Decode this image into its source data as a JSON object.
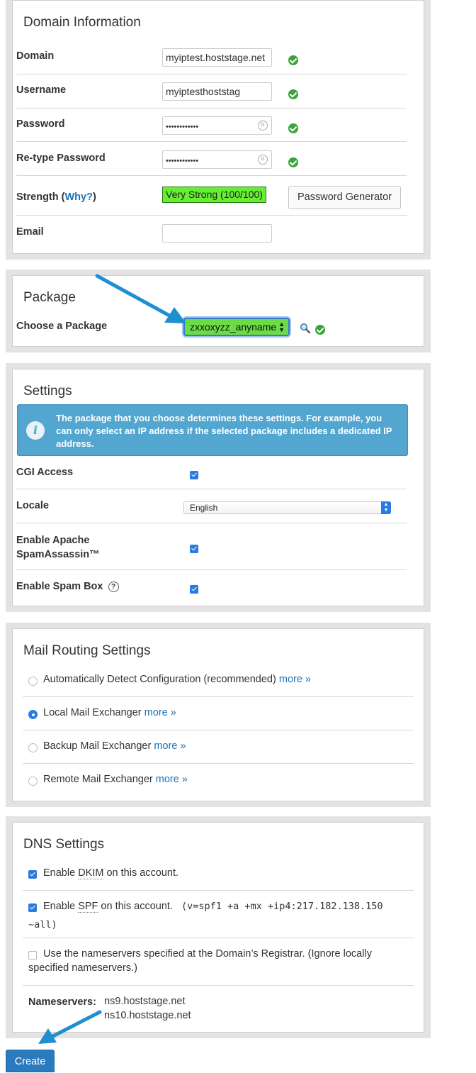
{
  "domain_info": {
    "title": "Domain Information",
    "domain_label": "Domain",
    "domain_value": "myiptest.hoststage.net",
    "username_label": "Username",
    "username_value": "myiptesthoststag",
    "password_label": "Password",
    "password_value": "••••••••••••",
    "retype_label": "Re-type Password",
    "retype_value": "••••••••••••",
    "strength_label": "Strength (",
    "strength_why": "Why?",
    "strength_close": ")",
    "strength_value": "Very Strong (100/100)",
    "generator_button": "Password Generator",
    "email_label": "Email",
    "email_value": ""
  },
  "package": {
    "title": "Package",
    "choose_label": "Choose a Package",
    "selected": "zxxoxyzz_anyname"
  },
  "settings": {
    "title": "Settings",
    "info": "The package that you choose determines these settings. For example, you can only select an IP address if the selected package includes a dedicated IP address.",
    "cgi_label": "CGI Access",
    "locale_label": "Locale",
    "locale_value": "English",
    "spamassassin_label_1": "Enable Apache",
    "spamassassin_label_2": "SpamAssassin™",
    "spambox_label": "Enable Spam Box",
    "help_glyph": "?"
  },
  "mail_routing": {
    "title": "Mail Routing Settings",
    "more": "more »",
    "options": [
      {
        "label": "Automatically Detect Configuration (recommended)",
        "selected": false
      },
      {
        "label": "Local Mail Exchanger",
        "selected": true
      },
      {
        "label": "Backup Mail Exchanger",
        "selected": false
      },
      {
        "label": "Remote Mail Exchanger",
        "selected": false
      }
    ]
  },
  "dns": {
    "title": "DNS Settings",
    "dkim_pre": "Enable",
    "dkim_abbr": "DKIM",
    "dkim_post": "on this account.",
    "spf_pre": "Enable",
    "spf_abbr": "SPF",
    "spf_post": "on this account.",
    "spf_record_1": "(v=spf1 +a +mx +ip4:217.182.138.150",
    "spf_record_2": "~all)",
    "registrar_line_1": "Use the nameservers specified at the Domain’s Registrar. (Ignore locally",
    "registrar_line_2": "specified nameservers.)",
    "nameservers_label": "Nameservers:",
    "ns1": "ns9.hoststage.net",
    "ns2": "ns10.hoststage.net"
  },
  "create_button": "Create",
  "colors": {
    "accent": "#2a7ae2",
    "ok_green": "#3aa53a",
    "strength_green": "#66ee33",
    "info_blue": "#53a6cf",
    "arrow_blue": "#1f8fd0",
    "link": "#1a73b8"
  }
}
